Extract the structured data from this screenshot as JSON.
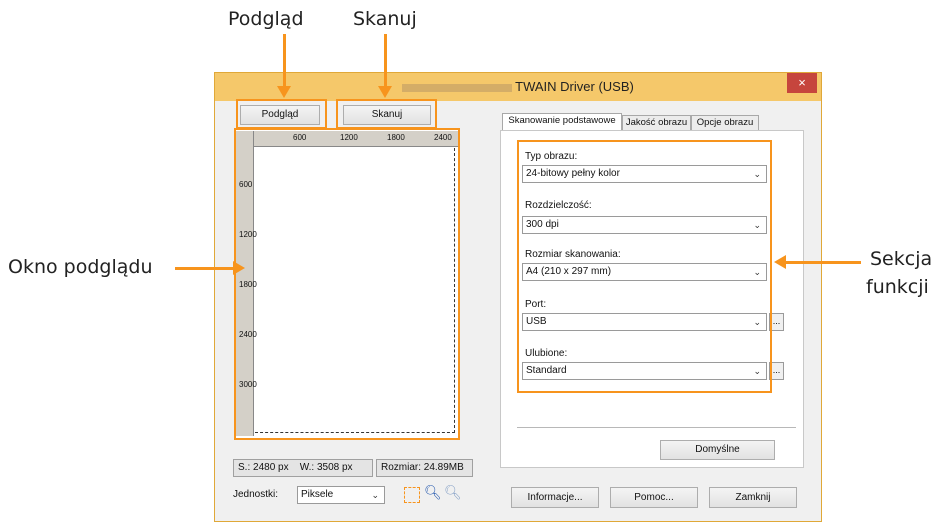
{
  "annotations": {
    "preview_label": "Podgląd",
    "scan_label": "Skanuj",
    "preview_window_label": "Okno podglądu",
    "function_section_line1": "Sekcja",
    "function_section_line2": "funkcji"
  },
  "window": {
    "title": "TWAIN Driver (USB)",
    "close": "×"
  },
  "toolbar": {
    "preview_button": "Podgląd",
    "scan_button": "Skanuj"
  },
  "ruler": {
    "unit": "px",
    "top_ticks": [
      "600",
      "1200",
      "1800",
      "2400"
    ],
    "left_ticks": [
      "600",
      "1200",
      "1800",
      "2400",
      "3000"
    ]
  },
  "status": {
    "width": "S.: 2480 px",
    "height": "W.: 3508 px",
    "size": "Rozmiar: 24.89MB"
  },
  "units": {
    "label": "Jednostki:",
    "value": "Piksele"
  },
  "tabs": [
    "Skanowanie podstawowe",
    "Jakość obrazu",
    "Opcje obrazu"
  ],
  "fields": {
    "image_type": {
      "label": "Typ obrazu:",
      "value": "24-bitowy pełny kolor"
    },
    "resolution": {
      "label": "Rozdzielczość:",
      "value": "300 dpi"
    },
    "scan_size": {
      "label": "Rozmiar skanowania:",
      "value": "A4 (210 x 297 mm)"
    },
    "port": {
      "label": "Port:",
      "value": "USB"
    },
    "favorites": {
      "label": "Ulubione:",
      "value": "Standard"
    }
  },
  "dots_label": "...",
  "buttons": {
    "defaults": "Domyślne",
    "info": "Informacje...",
    "help": "Pomoc...",
    "close": "Zamknij"
  },
  "colors": {
    "annotation": "#f7941d",
    "titlebar": "#f5c86a",
    "close_button": "#c6453d"
  }
}
